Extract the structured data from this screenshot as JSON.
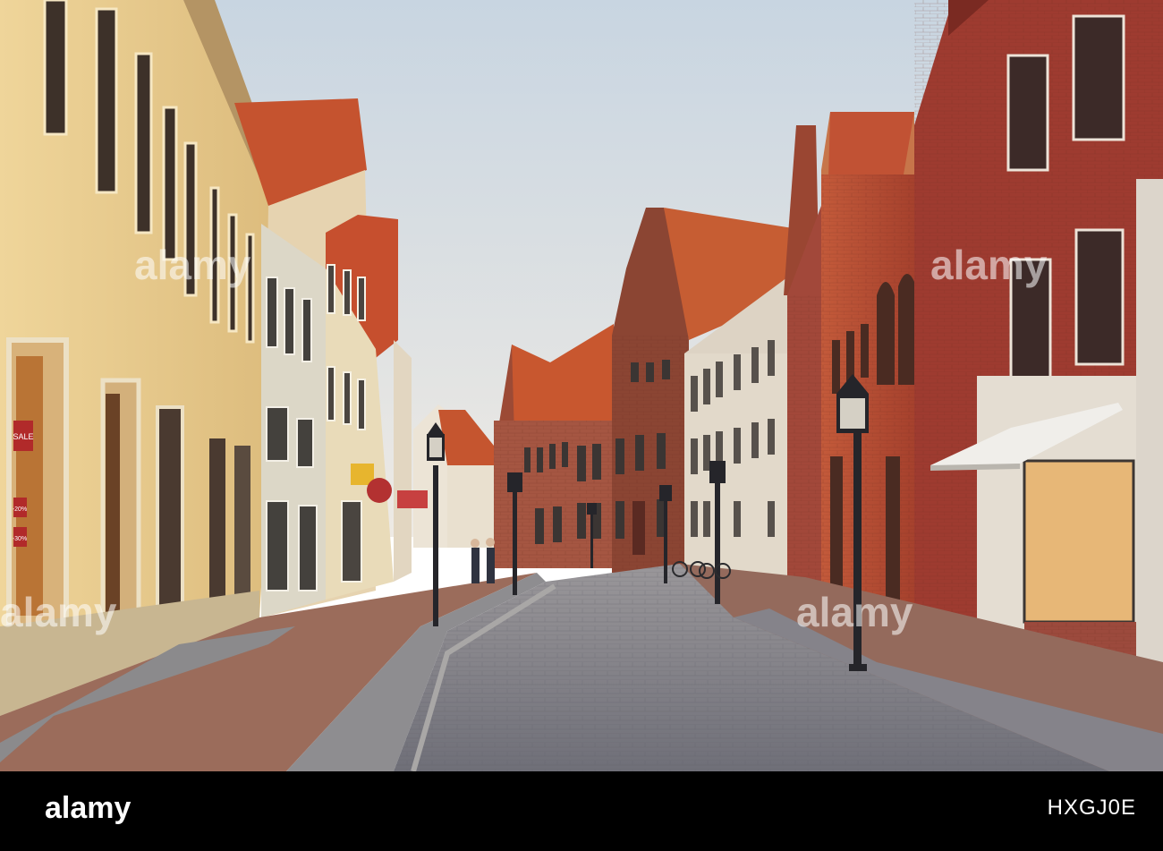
{
  "photo": {
    "subject": "cobblestone street lined with historic gabled townhouses at dusk",
    "palette": {
      "sky": "#dde4ea",
      "roof": "#c5512e",
      "brick": "#8a3d2c",
      "facade_yellow": "#e8c98a",
      "cobble": "#7f8088",
      "sidewalk": "#9a6a59",
      "lamp": "#2a2a2c"
    }
  },
  "signs": {
    "sale": "SALE",
    "discount_1": "-20%",
    "discount_2": "-30%"
  },
  "watermark": {
    "text": "alamy"
  },
  "footer": {
    "brand": "alamy",
    "image_id": "HXGJ0E"
  }
}
